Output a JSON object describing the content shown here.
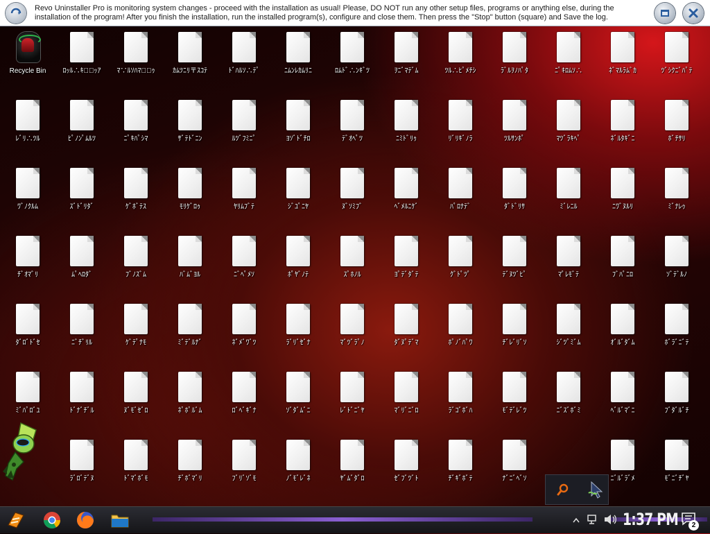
{
  "banner": {
    "message": "Revo Uninstaller Pro is monitoring system changes - proceed with the installation as usual! Please, DO NOT run any other setup files, programs or anything else, during the installation of the program! After you finish the installation, run the installed program(s), configure and close them. Then press the \"Stop\" button (square) and Save the log."
  },
  "desktop": {
    "icons": [
      [
        "Recycle Bin",
        "ﾛｯﾙ∴ｷ≒ﾞｯｱ",
        "ﾏ∵ﾙｿﾊﾏ≒ﾞｩ",
        "ｶﾑﾂﾆﾘ〒ｽｺﾃ",
        "ﾄﾞﾊﾙｿ∴ﾃﾟ",
        "ﾆﾑﾝﾚｶﾑﾘﾆ",
        "ﾛﾑﾄﾞ∴ﾝｷﾞﾂ",
        "ｦﾆﾞﾏﾃﾞﾑ",
        "ﾂﾙ∴ﾋﾟﾒﾁｼ",
        "ﾗﾞﾙｦﾉﾊﾟﾀ",
        "ﾆﾟｷﾛﾑｿ∴",
        "ﾈﾞﾏﾙﾗﾑﾞｶ",
        "ﾂﾞｼｸﾆﾞﾊﾟﾃ"
      ],
      [
        "ﾚﾞﾘ∴ﾂﾙ",
        "ﾋﾟﾉﾝﾟﾑﾙﾂ",
        "ﾆﾟｷﾊﾟｼﾏ",
        "ｻﾞﾃﾄﾞﾆﾝ",
        "ﾙﾂﾞﾌﾐﾆﾟ",
        "ﾖｿﾞﾄﾞﾁﾛ",
        "ﾃﾞｵﾍﾟﾂ",
        "ﾆﾐﾄﾞﾘｩ",
        "ﾘﾞﾘｷﾞﾉﾗ",
        "ﾂﾙｻﾝﾎﾟ",
        "ﾏﾂﾞﾗｷﾍﾟ",
        "ﾈﾞﾙﾀｷﾞﾆ",
        "ﾎﾞﾁｻﾘ"
      ],
      [
        "ﾜﾞﾉｸﾙﾑ",
        "ｽﾞﾄﾞﾘﾀﾞ",
        "ｹﾞﾎﾞﾃｽ",
        "ﾓﾘｹﾞﾛｩ",
        "ﾔﾘﾑﾌﾞﾃ",
        "ｼﾞﾕﾟﾆﾔ",
        "ﾇﾞｿﾐﾌﾞ",
        "ﾍﾞﾒﾙﾆｹﾞ",
        "ﾊﾟﾛﾅﾃﾞ",
        "ﾀﾞﾄﾞﾘｻ",
        "ﾐﾞﾚﾆﾙ",
        "ﾆﾜﾞﾇﾙﾘ",
        "ﾐﾞﾅﾚｩ"
      ],
      [
        "ﾁﾞｵﾏﾞﾘ",
        "ﾑﾟﾍﾛﾀﾞ",
        "ﾌﾞﾉｽﾞﾑ",
        "ﾊﾞﾑﾞﾖﾙ",
        "ﾆﾞﾍﾟﾒｿ",
        "ﾎﾟﾔﾞﾉﾃ",
        "ｽﾟﾎﾉﾙ",
        "ﾖﾟﾃﾞﾀﾞﾃ",
        "ｸﾞﾄﾟﾂﾟ",
        "ﾃﾞﾇﾂﾞﾋﾟ",
        "ﾏﾟﾚﾓﾞﾃ",
        "ﾌﾞﾊﾟﾆﾛ",
        "ｿﾞﾃﾞﾙﾉ"
      ],
      [
        "ﾀﾞﾛﾞﾄﾞｾ",
        "ﾆﾞﾁﾞﾘﾙ",
        "ｹﾞﾃﾟﾅﾓ",
        "ﾐﾞﾃﾞﾙﾅﾞ",
        "ﾈﾞﾒﾞﾜﾞﾂ",
        "ﾗﾞﾘﾞｾﾞﾅ",
        "ﾏﾞﾂﾞﾗﾟﾉ",
        "ﾀﾞﾇﾟﾃﾞﾏ",
        "ﾎﾟﾉﾞﾊﾟﾜ",
        "ﾁﾞﾚﾞﾘﾞｿ",
        "ｼﾞﾂﾟﾐﾞﾑ",
        "ｵﾞﾙﾞﾀﾞﾑ",
        "ﾎﾞﾗﾞﾆﾞﾃ"
      ],
      [
        "ﾐﾞﾊﾟﾛﾞﾕ",
        "ﾄﾞﾅﾞﾁﾞﾙ",
        "ﾇﾞﾓﾞｾﾞﾛ",
        "ﾈﾟﾎﾟﾙﾞﾑ",
        "ﾛﾞﾍﾞｷﾞﾅ",
        "ｿﾞﾀﾞﾑﾞﾆ",
        "ﾚﾞﾄﾞﾆﾞﾔ",
        "ﾏﾞﾘﾞﾆﾞﾛ",
        "ﾗﾞｺﾞﾎﾞﾊ",
        "ﾓﾞﾃﾞﾚﾞﾂ",
        "ﾆﾞｽﾞﾎﾞﾐ",
        "ﾍﾞﾙﾞﾏﾞﾆ",
        "ﾌﾞﾀﾞﾙﾞﾁ"
      ],
      [
        "",
        "ﾗﾞﾛﾞﾃﾞﾇ",
        "ﾄﾞﾏﾞﾎﾞﾓ",
        "ﾁﾞﾎﾞﾏﾞﾘ",
        "ﾌﾞﾘﾞｿﾞﾓ",
        "ﾉﾞﾓﾞﾚﾞﾈ",
        "ﾔﾞﾑﾞﾀﾞﾛ",
        "ｾﾞﾌﾞﾂﾞﾄ",
        "ﾁﾞｷﾞﾎﾞﾃ",
        "ﾅﾞﾆﾞﾍﾞｿ",
        "",
        "ﾆﾞﾙﾞﾗﾞﾒ",
        "ﾓﾞﾆﾞﾁﾞﾔ"
      ]
    ]
  },
  "taskbar": {
    "clock": "1:37 PM",
    "notification_count": "2",
    "accent": "#8a5fd1"
  }
}
